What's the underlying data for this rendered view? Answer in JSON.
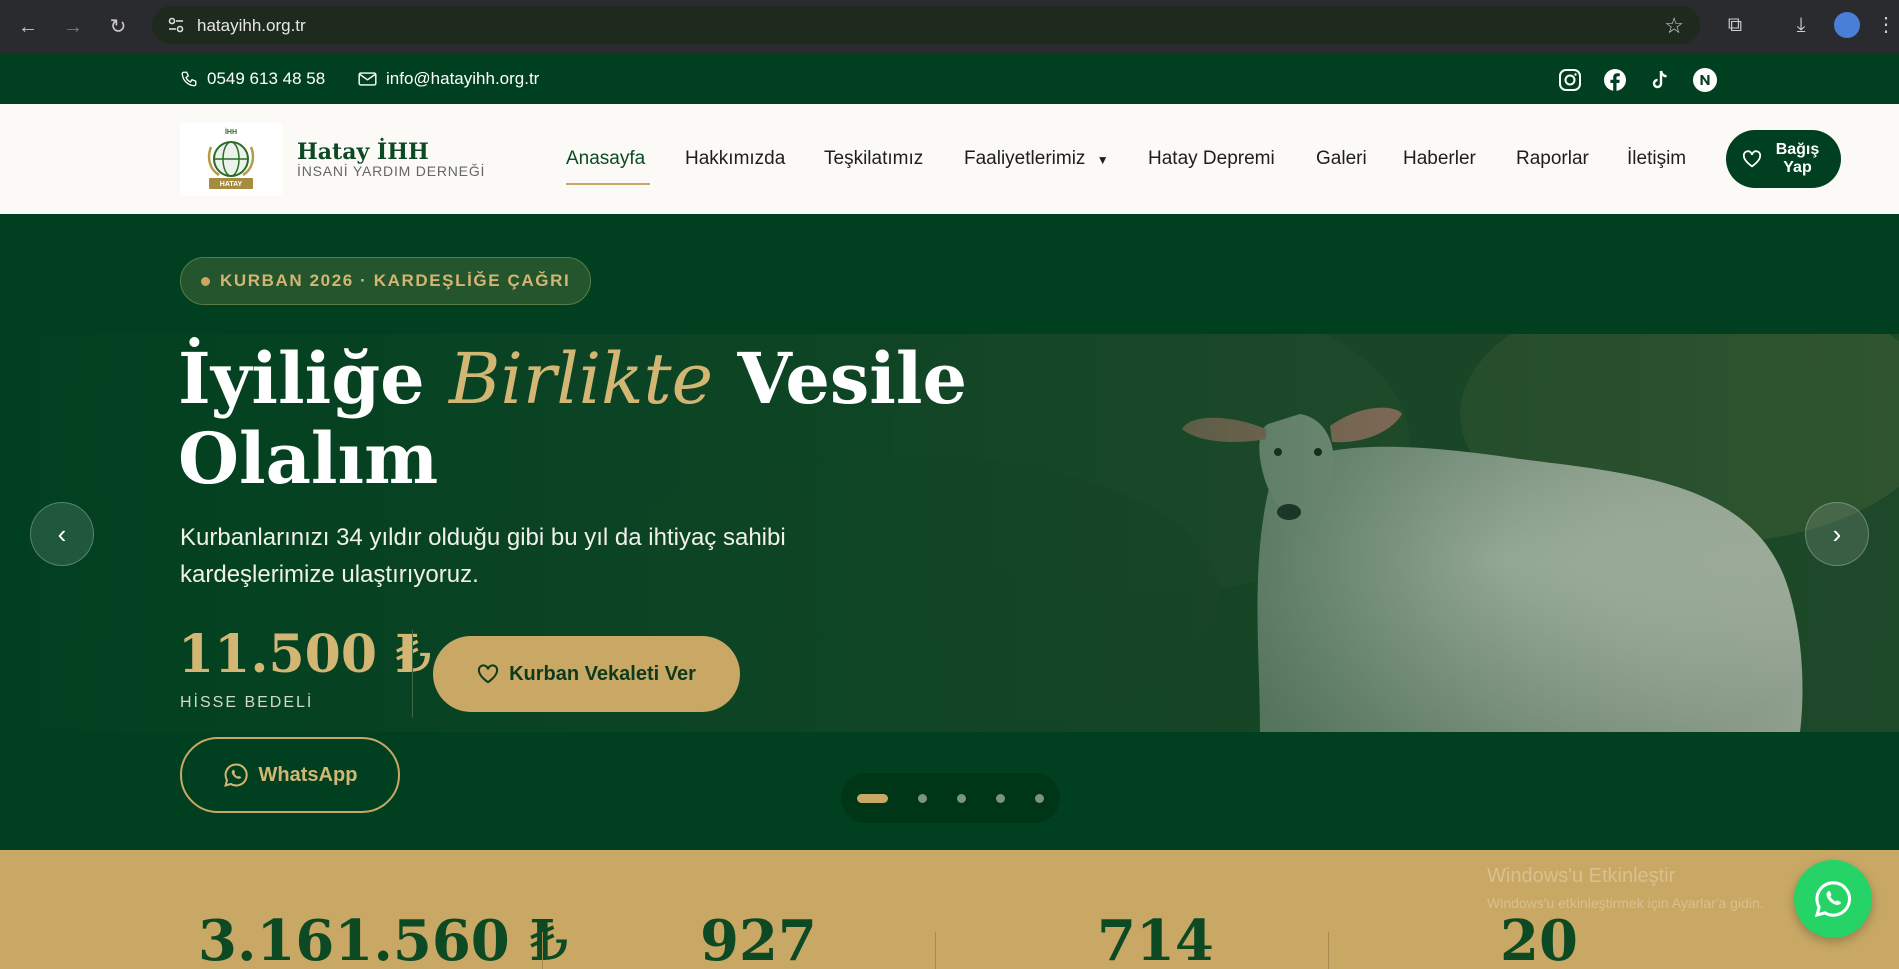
{
  "browser": {
    "url": "hatayihh.org.tr"
  },
  "topbar": {
    "phone": "0549 613 48 58",
    "email": "info@hatayihh.org.tr",
    "social": [
      "instagram-icon",
      "facebook-icon",
      "tiktok-icon",
      "n-icon"
    ]
  },
  "header": {
    "logo_text": "HATAY",
    "logo_mark": "İHH",
    "brand_name": "Hatay İHH",
    "brand_sub": "İNSANİ YARDIM DERNEĞİ",
    "menu": [
      "Anasayfa",
      "Hakkımızda",
      "Teşkilatımız",
      "Faaliyetlerimiz",
      "Hatay Depremi",
      "Galeri",
      "Haberler",
      "Raporlar",
      "İletişim"
    ],
    "donate_label": "Bağış Yap"
  },
  "hero": {
    "tag": "KURBAN 2026 · KARDEŞLİĞE ÇAĞRI",
    "title_part1": "İyiliğe ",
    "title_accent": "Birlikte",
    "title_part2": " Vesile",
    "title_line2": "Olalım",
    "description": "Kurbanlarınızı 34 yıldır olduğu gibi bu yıl da ihtiyaç sahibi kardeşlerimize ulaştırıyoruz.",
    "price": "11.500 ₺",
    "price_label": "HİSSE BEDELİ",
    "cta_label": "Kurban Vekaleti Ver",
    "whatsapp_label": "WhatsApp",
    "slides": 5,
    "active_slide": 1
  },
  "stats": {
    "values": [
      "3.161.560 ₺",
      "927",
      "714",
      "20"
    ]
  },
  "watermark": {
    "line1": "Windows'u Etkinleştir",
    "line2": "Windows'u etkinleştirmek için Ayarlar'a gidin."
  },
  "colors": {
    "brand_green": "#004020",
    "gold": "#c9a865",
    "whatsapp": "#25d366"
  }
}
